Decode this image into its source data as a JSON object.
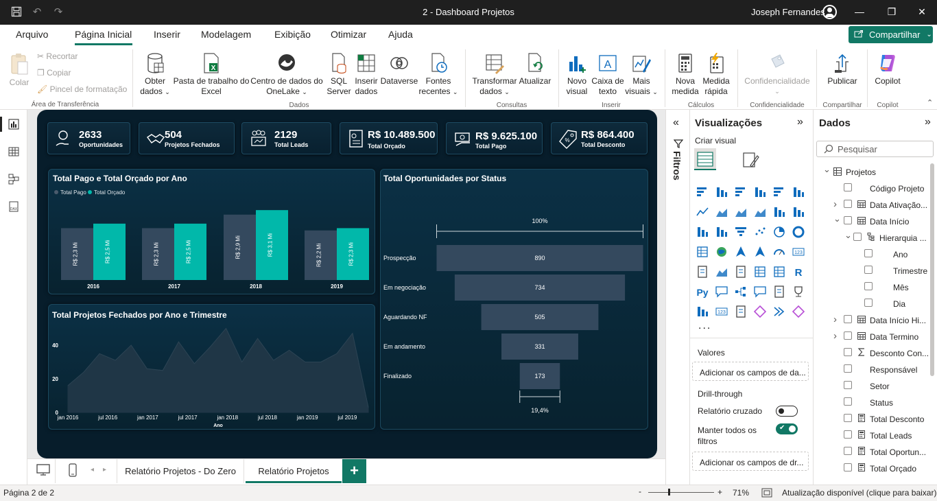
{
  "window": {
    "title": "2 - Dashboard Projetos",
    "user": "Joseph Fernandes"
  },
  "menu": {
    "tabs": [
      "Arquivo",
      "Página Inicial",
      "Inserir",
      "Modelagem",
      "Exibição",
      "Otimizar",
      "Ajuda"
    ],
    "share_label": "Compartilhar"
  },
  "ribbon": {
    "clipboard": {
      "paste": "Colar",
      "cut": "Recortar",
      "copy": "Copiar",
      "format_painter": "Pincel de formatação",
      "group": "Área de Transferência"
    },
    "data": {
      "get_data": [
        "Obter",
        "dados"
      ],
      "excel": [
        "Pasta de trabalho do",
        "Excel"
      ],
      "onelake": [
        "Centro de dados do",
        "OneLake"
      ],
      "sql": [
        "SQL",
        "Server"
      ],
      "insert_data": [
        "Inserir",
        "dados"
      ],
      "dataverse": "Dataverse",
      "recent": [
        "Fontes",
        "recentes"
      ],
      "group": "Dados"
    },
    "queries": {
      "transform": [
        "Transformar",
        "dados"
      ],
      "refresh": "Atualizar",
      "group": "Consultas"
    },
    "insert": {
      "new_visual": [
        "Novo",
        "visual"
      ],
      "text_box": [
        "Caixa de",
        "texto"
      ],
      "more_visuals": [
        "Mais",
        "visuais"
      ],
      "group": "Inserir"
    },
    "calculations": {
      "new_measure": [
        "Nova",
        "medida"
      ],
      "quick_measure": [
        "Medida",
        "rápida"
      ],
      "group": "Cálculos"
    },
    "confidentiality": {
      "label": "Confidencialidade",
      "group": "Confidencialidade"
    },
    "share": {
      "publish": "Publicar",
      "group": "Compartilhar"
    },
    "copilot": {
      "label": "Copilot",
      "group": "Copilot"
    }
  },
  "kpis": [
    {
      "value": "2633",
      "label": "Oportunidades"
    },
    {
      "value": "504",
      "label": "Projetos Fechados"
    },
    {
      "value": "2129",
      "label": "Total Leads"
    },
    {
      "value": "R$ 10.489.500",
      "label": "Total Orçado"
    },
    {
      "value": "R$ 9.625.100",
      "label": "Total Pago"
    },
    {
      "value": "R$ 864.400",
      "label": "Total Desconto"
    }
  ],
  "chart_data": [
    {
      "type": "bar",
      "title": "Total Pago e Total Orçado por Ano",
      "categories": [
        "2016",
        "2017",
        "2018",
        "2019"
      ],
      "series": [
        {
          "name": "Total Pago",
          "values": [
            2.3,
            2.3,
            2.9,
            2.2
          ],
          "labels": [
            "R$ 2,3 Mi",
            "R$ 2,3 Mi",
            "R$ 2,9 Mi",
            "R$ 2,2 Mi"
          ],
          "color": "#34495e"
        },
        {
          "name": "Total Orçado",
          "values": [
            2.5,
            2.5,
            3.1,
            2.3
          ],
          "labels": [
            "R$ 2,5 Mi",
            "R$ 2,5 Mi",
            "R$ 3,1 Mi",
            "R$ 2,3 Mi"
          ],
          "color": "#01b8aa"
        }
      ],
      "legend": "top-left"
    },
    {
      "type": "area",
      "title": "Total Projetos Fechados por Ano e Trimestre",
      "xlabel": "Ano",
      "x_ticks": [
        "jan 2016",
        "jul 2016",
        "jan 2017",
        "jul 2017",
        "jan 2018",
        "jul 2018",
        "jan 2019",
        "jul 2019"
      ],
      "y_ticks": [
        "0",
        "20",
        "40"
      ],
      "ylim": [
        0,
        50
      ],
      "values": [
        16,
        24,
        35,
        31,
        40,
        26,
        25,
        42,
        29,
        39,
        50,
        30,
        44,
        31,
        37,
        30,
        30,
        35,
        47,
        3
      ]
    },
    {
      "type": "funnel",
      "title": "Total Oportunidades por Status",
      "categories": [
        "Prospecção",
        "Em negociação",
        "Aguardando NF",
        "Em andamento",
        "Finalizado"
      ],
      "values": [
        890,
        734,
        505,
        331,
        173
      ],
      "labels": [
        "890",
        "734",
        "505",
        "331",
        "173"
      ],
      "top_percent": "100%",
      "bottom_percent": "19,4%"
    }
  ],
  "page_tabs": [
    "Relatório Projetos - Do Zero",
    "Relatório Projetos"
  ],
  "status": {
    "page": "Página 2 de 2",
    "zoom": "71%",
    "update": "Atualização disponível (clique para baixar)"
  },
  "filters": {
    "label": "Filtros"
  },
  "viz_pane": {
    "title": "Visualizações",
    "build_label": "Criar visual",
    "more": "...",
    "values_label": "Valores",
    "values_placeholder": "Adicionar os campos de da...",
    "drillthrough_label": "Drill-through",
    "cross_report": "Relatório cruzado",
    "keep_filters": [
      "Manter todos os",
      "filtros"
    ],
    "drill_placeholder": "Adicionar os campos de dr..."
  },
  "data_pane": {
    "title": "Dados",
    "search_placeholder": "Pesquisar",
    "tree": [
      {
        "label": "Projetos",
        "level": 0,
        "chevron": "open",
        "checkbox": false,
        "icon": "table-icon"
      },
      {
        "label": "Código Projeto",
        "level": 1,
        "chevron": "",
        "checkbox": true,
        "icon": ""
      },
      {
        "label": "Data Ativação...",
        "level": 1,
        "chevron": "closed",
        "checkbox": true,
        "icon": "calendar-icon"
      },
      {
        "label": "Data Início",
        "level": 1,
        "chevron": "open",
        "checkbox": true,
        "icon": "calendar-icon"
      },
      {
        "label": "Hierarquia ...",
        "level": 2,
        "chevron": "open",
        "checkbox": true,
        "icon": "hierarchy-icon"
      },
      {
        "label": "Ano",
        "level": 3,
        "chevron": "",
        "checkbox": true,
        "icon": ""
      },
      {
        "label": "Trimestre",
        "level": 3,
        "chevron": "",
        "checkbox": true,
        "icon": ""
      },
      {
        "label": "Mês",
        "level": 3,
        "chevron": "",
        "checkbox": true,
        "icon": ""
      },
      {
        "label": "Dia",
        "level": 3,
        "chevron": "",
        "checkbox": true,
        "icon": ""
      },
      {
        "label": "Data Início Hi...",
        "level": 1,
        "chevron": "closed",
        "checkbox": true,
        "icon": "calendar-icon"
      },
      {
        "label": "Data Termino",
        "level": 1,
        "chevron": "closed",
        "checkbox": true,
        "icon": "calendar-icon"
      },
      {
        "label": "Desconto Con...",
        "level": 1,
        "chevron": "",
        "checkbox": true,
        "icon": "sigma-icon"
      },
      {
        "label": "Responsável",
        "level": 1,
        "chevron": "",
        "checkbox": true,
        "icon": ""
      },
      {
        "label": "Setor",
        "level": 1,
        "chevron": "",
        "checkbox": true,
        "icon": ""
      },
      {
        "label": "Status",
        "level": 1,
        "chevron": "",
        "checkbox": true,
        "icon": ""
      },
      {
        "label": "Total Desconto",
        "level": 1,
        "chevron": "",
        "checkbox": true,
        "icon": "calculator-icon"
      },
      {
        "label": "Total Leads",
        "level": 1,
        "chevron": "",
        "checkbox": true,
        "icon": "calculator-icon"
      },
      {
        "label": "Total Oportun...",
        "level": 1,
        "chevron": "",
        "checkbox": true,
        "icon": "calculator-icon"
      },
      {
        "label": "Total Orçado",
        "level": 1,
        "chevron": "",
        "checkbox": true,
        "icon": "calculator-icon"
      }
    ]
  },
  "colors": {
    "accent": "#117865",
    "canvas": "#071d2b",
    "teal": "#01b8aa",
    "slate": "#34495e"
  }
}
